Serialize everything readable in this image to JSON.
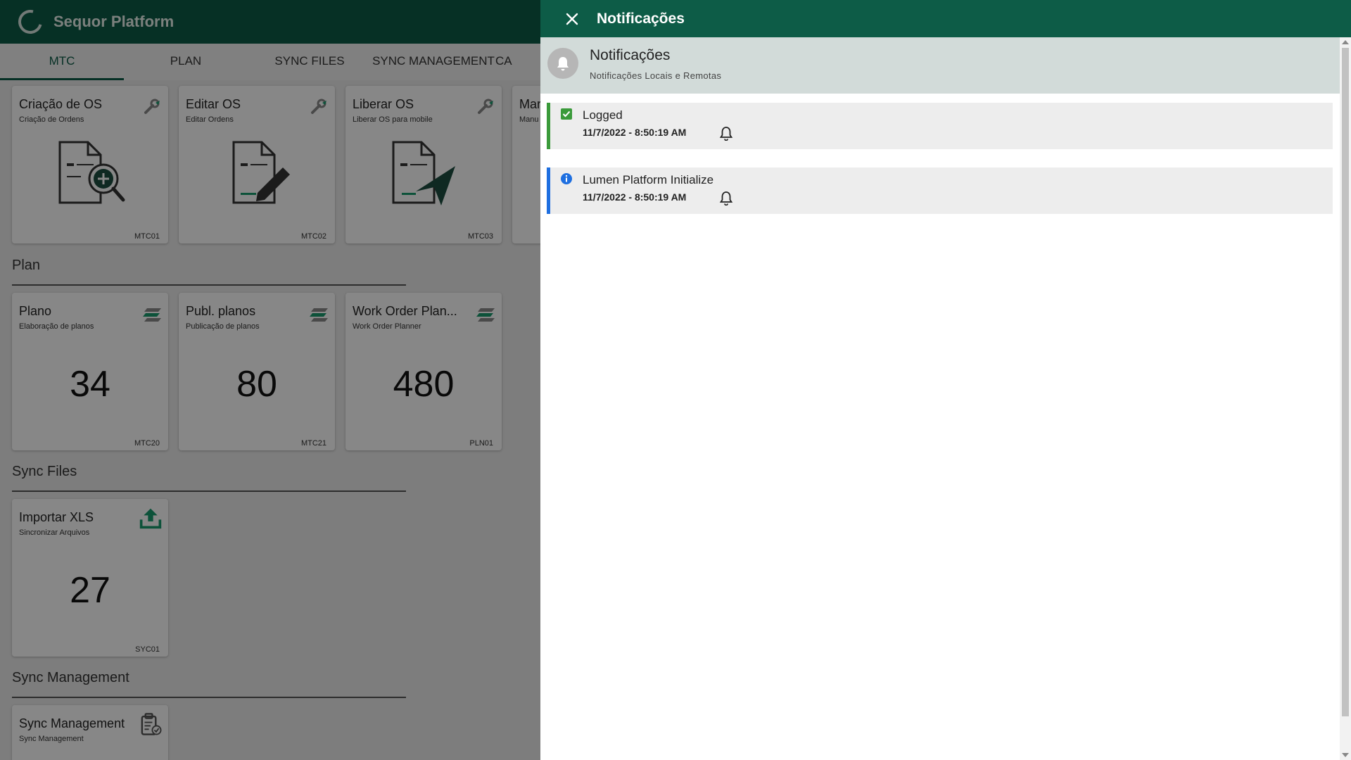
{
  "app": {
    "title": "Sequor Platform"
  },
  "tabs": [
    {
      "label": "MTC",
      "active": true
    },
    {
      "label": "PLAN",
      "active": false
    },
    {
      "label": "SYNC FILES",
      "active": false
    },
    {
      "label": "SYNC MANAGEMENT",
      "active": false
    },
    {
      "label": "CA",
      "active": false
    }
  ],
  "mtc_cards": [
    {
      "title": "Criação de OS",
      "subtitle": "Criação de Ordens",
      "code": "MTC01",
      "icon": "document-add-search-icon"
    },
    {
      "title": "Editar OS",
      "subtitle": "Editar Ordens",
      "code": "MTC02",
      "icon": "document-edit-icon"
    },
    {
      "title": "Liberar OS",
      "subtitle": "Liberar OS para mobile",
      "code": "MTC03",
      "icon": "document-send-icon"
    },
    {
      "title": "Mar",
      "subtitle": "Manu",
      "code": "",
      "icon": ""
    }
  ],
  "sections": {
    "plan": "Plan",
    "sync_files": "Sync Files",
    "sync_management": "Sync Management"
  },
  "plan_cards": [
    {
      "title": "Plano",
      "subtitle": "Elaboração de planos",
      "value": "34",
      "code": "MTC20"
    },
    {
      "title": "Publ. planos",
      "subtitle": "Publicação de planos",
      "value": "80",
      "code": "MTC21"
    },
    {
      "title": "Work Order Plan...",
      "subtitle": "Work Order Planner",
      "value": "480",
      "code": "PLN01"
    }
  ],
  "sync_files_cards": [
    {
      "title": "Importar XLS",
      "subtitle": "Sincronizar Arquivos",
      "value": "27",
      "code": "SYC01"
    }
  ],
  "sync_management_cards": [
    {
      "title": "Sync Management",
      "subtitle": "Sync Management"
    }
  ],
  "drawer": {
    "title": "Notificações",
    "banner_title": "Notificações",
    "banner_subtitle": "Notificações Locais e Remotas",
    "notifications": [
      {
        "title": "Logged",
        "time": "11/7/2022 - 8:50:19 AM",
        "type": "success"
      },
      {
        "title": "Lumen Platform Initialize",
        "time": "11/7/2022 - 8:50:19 AM",
        "type": "info"
      }
    ]
  },
  "colors": {
    "primary": "#0d5c47",
    "success": "#3a9a3a",
    "info": "#1e6fe0",
    "accent": "#1a9b6f"
  }
}
